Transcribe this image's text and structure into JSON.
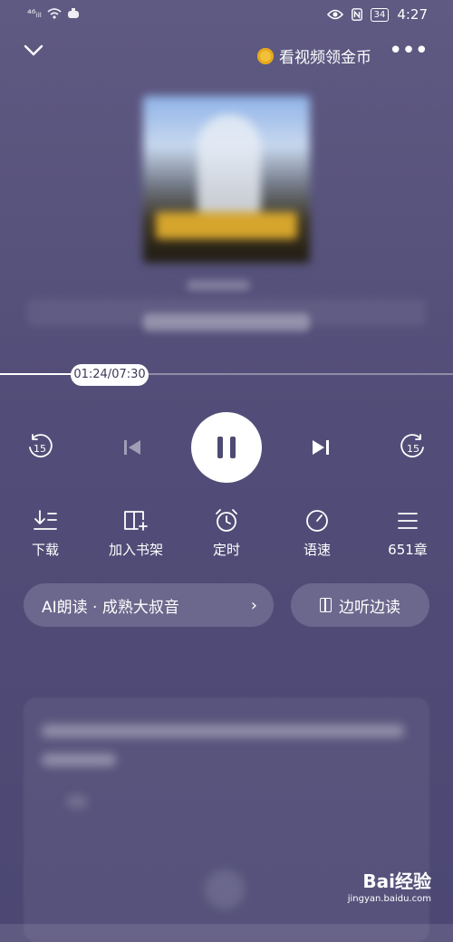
{
  "status_bar": {
    "signal": "⁴⁶ᵢₗₗ",
    "battery": "34",
    "time": "4:27"
  },
  "topbar": {
    "earn_label": "看视频领金币",
    "more_label": "•••"
  },
  "progress": {
    "time_label": "01:24/07:30",
    "fraction": 0.1867
  },
  "controls": {
    "rewind_seconds": "15",
    "forward_seconds": "15"
  },
  "actions": [
    {
      "label": "下载"
    },
    {
      "label": "加入书架"
    },
    {
      "label": "定时"
    },
    {
      "label": "语速"
    },
    {
      "label": "651章"
    }
  ],
  "voice": {
    "label": "AI朗读 · 成熟大叔音"
  },
  "read_along": {
    "label": "边听边读"
  },
  "watermark": {
    "brand": "Bai经验",
    "url": "jingyan.baidu.com"
  }
}
